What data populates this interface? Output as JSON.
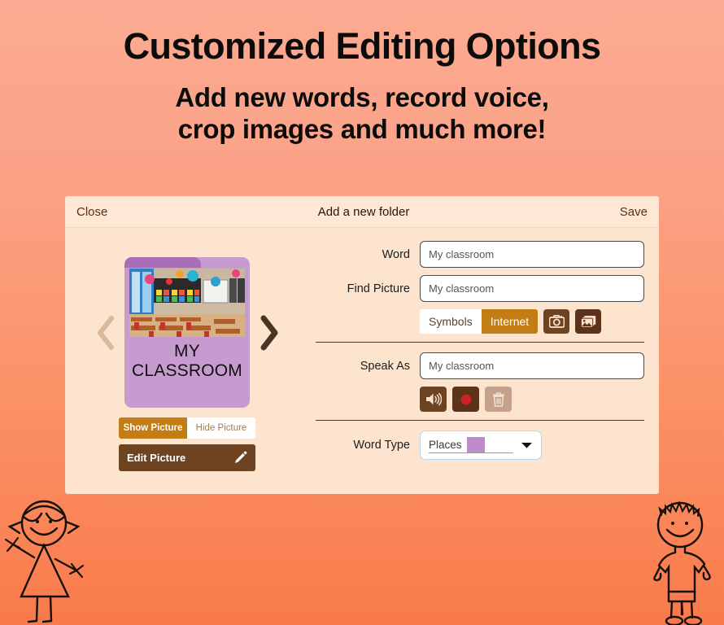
{
  "headline": {
    "title": "Customized Editing Options",
    "subtitle_line1": "Add new words, record voice,",
    "subtitle_line2": "crop images and much more!"
  },
  "panel": {
    "header": {
      "close_label": "Close",
      "title": "Add a new folder",
      "save_label": "Save"
    },
    "preview": {
      "card_label_line1": "MY",
      "card_label_line2": "CLASSROOM",
      "prev_arrow": "chevron-left",
      "next_arrow": "chevron-right",
      "show_picture_label": "Show Picture",
      "hide_picture_label": "Hide Picture",
      "edit_picture_label": "Edit Picture",
      "edit_icon": "pencil-icon",
      "card_color": "#c79bd0",
      "tab_color": "#a86fb6"
    },
    "fields": {
      "word_label": "Word",
      "word_value": "My classroom",
      "find_picture_label": "Find Picture",
      "find_picture_value": "My classroom",
      "symbols_label": "Symbols",
      "internet_label": "Internet",
      "camera_icon": "camera-icon",
      "gallery_icon": "gallery-icon",
      "speak_as_label": "Speak As",
      "speak_as_value": "My classroom",
      "play_icon": "speaker-icon",
      "record_icon": "record-icon",
      "delete_icon": "trash-icon",
      "word_type_label": "Word Type",
      "word_type_value": "Places",
      "word_type_swatch": "#bf8bcd",
      "dropdown_icon": "chevron-down-icon"
    }
  },
  "decorations": {
    "girl_figure": "stick-figure-girl",
    "boy_figure": "stick-figure-boy"
  },
  "colors": {
    "accent_gold": "#c47c15",
    "brown": "#6e4322",
    "panel_bg": "#fce4cf",
    "header_bg": "#fde8d6"
  }
}
